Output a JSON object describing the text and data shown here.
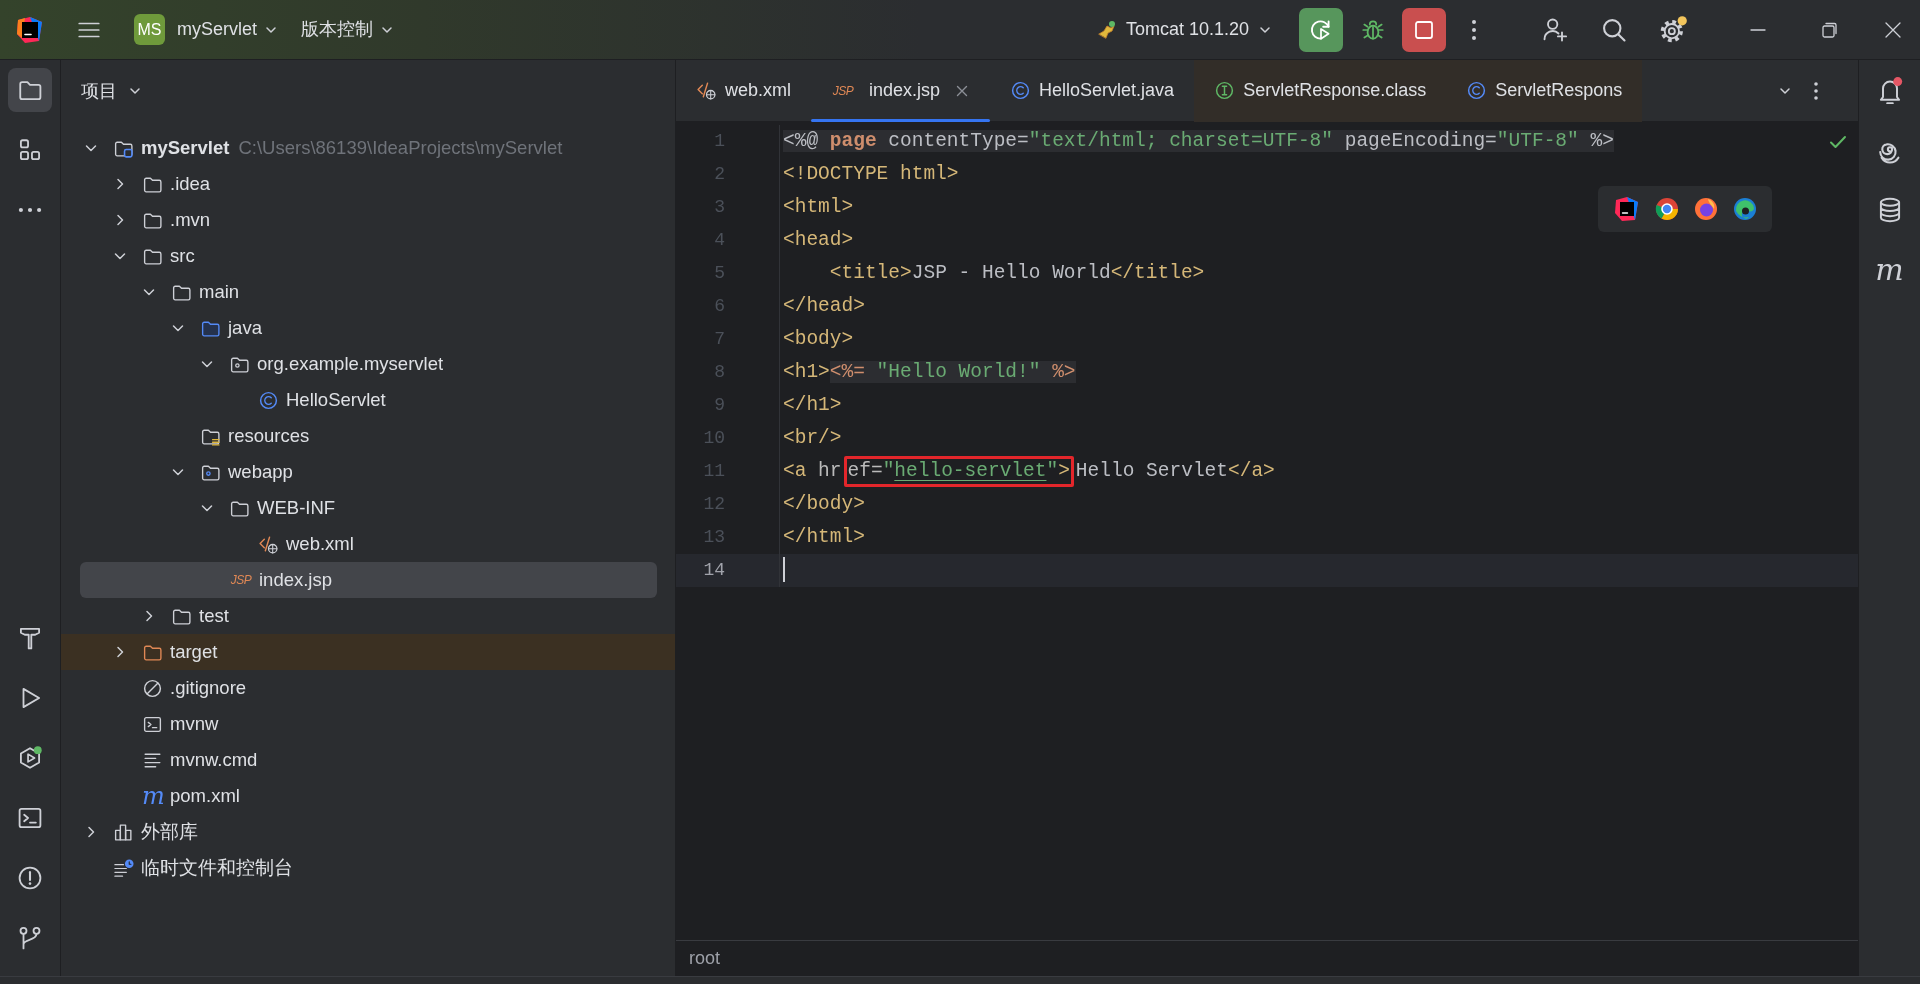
{
  "title_bar": {
    "project": {
      "badge": "MS",
      "name": "myServlet"
    },
    "vcs_menu": "版本控制",
    "run_config": "Tomcat 10.1.20"
  },
  "left_tools_top": [
    {
      "kind": "project",
      "selected": true
    },
    {
      "kind": "structure",
      "selected": false
    },
    {
      "kind": "more",
      "selected": false
    }
  ],
  "left_tools_bottom": [
    {
      "kind": "build",
      "selected": false
    },
    {
      "kind": "run",
      "selected": false
    },
    {
      "kind": "services",
      "selected": false
    },
    {
      "kind": "terminal",
      "selected": false
    },
    {
      "kind": "problems",
      "selected": false
    },
    {
      "kind": "git",
      "selected": false
    }
  ],
  "right_tools": [
    {
      "kind": "notifications"
    },
    {
      "kind": "ai"
    },
    {
      "kind": "database"
    },
    {
      "kind": "maven",
      "glyph": "m"
    }
  ],
  "project_panel": {
    "title": "项目",
    "tree": [
      {
        "label": "myServlet",
        "path": "C:\\Users\\86139\\IdeaProjects\\myServlet",
        "kind": "project",
        "expanded": true,
        "selected": false,
        "children": [
          {
            "label": ".idea",
            "kind": "folder",
            "expanded": false,
            "selected": false
          },
          {
            "label": ".mvn",
            "kind": "folder",
            "expanded": false,
            "selected": false
          },
          {
            "label": "src",
            "kind": "folder",
            "expanded": true,
            "selected": false,
            "children": [
              {
                "label": "main",
                "kind": "folder",
                "expanded": true,
                "selected": false,
                "children": [
                  {
                    "label": "java",
                    "kind": "source",
                    "expanded": true,
                    "selected": false,
                    "children": [
                      {
                        "label": "org.example.myservlet",
                        "kind": "package",
                        "expanded": true,
                        "selected": false,
                        "children": [
                          {
                            "label": "HelloServlet",
                            "kind": "class",
                            "selected": false
                          }
                        ]
                      }
                    ]
                  },
                  {
                    "label": "resources",
                    "kind": "resources",
                    "selected": false
                  },
                  {
                    "label": "webapp",
                    "kind": "webapp",
                    "expanded": true,
                    "selected": false,
                    "children": [
                      {
                        "label": "WEB-INF",
                        "kind": "folder",
                        "expanded": true,
                        "selected": false,
                        "children": [
                          {
                            "label": "web.xml",
                            "kind": "xml",
                            "selected": false
                          }
                        ]
                      },
                      {
                        "label": "index.jsp",
                        "kind": "jsp",
                        "glyph": "JSP",
                        "selected": true
                      }
                    ]
                  }
                ]
              },
              {
                "label": "test",
                "kind": "folder",
                "expanded": false,
                "selected": false
              }
            ]
          },
          {
            "label": "target",
            "kind": "excluded",
            "expanded": false,
            "selected": false
          },
          {
            "label": ".gitignore",
            "kind": "gitignore",
            "selected": false
          },
          {
            "label": "mvnw",
            "kind": "shell",
            "selected": false
          },
          {
            "label": "mvnw.cmd",
            "kind": "text",
            "selected": false
          },
          {
            "label": "pom.xml",
            "kind": "maven",
            "glyph": "m",
            "selected": false
          }
        ]
      },
      {
        "label": "外部库",
        "kind": "library",
        "expanded": false,
        "selected": false
      },
      {
        "label": "临时文件和控制台",
        "kind": "scratch",
        "selected": false
      }
    ]
  },
  "editor": {
    "tabs": [
      {
        "label": "web.xml",
        "kind": "xml",
        "selected": false,
        "library": false
      },
      {
        "label": "index.jsp",
        "kind": "jsp",
        "glyph": "JSP",
        "selected": true,
        "library": false
      },
      {
        "label": "HelloServlet.java",
        "kind": "class",
        "selected": false,
        "library": false
      },
      {
        "label": "ServletResponse.class",
        "kind": "interface",
        "selected": false,
        "library": true
      },
      {
        "label": "ServletRespons",
        "kind": "class",
        "selected": false,
        "library": true
      }
    ],
    "lines": [
      {
        "number": "1",
        "current": false,
        "tokens": [
          {
            "kind": "jsp",
            "tokens": [
              {
                "kind": "text",
                "text": "<%@ "
              },
              {
                "kind": "keyword",
                "text": "page"
              },
              {
                "kind": "text",
                "text": " contentType="
              },
              {
                "kind": "string",
                "text": "\"text/html; charset=UTF-8\""
              },
              {
                "kind": "text",
                "text": " pageEncoding="
              },
              {
                "kind": "string",
                "text": "\"UTF-8\""
              },
              {
                "kind": "text",
                "text": " %>"
              }
            ]
          }
        ]
      },
      {
        "number": "2",
        "current": false,
        "tokens": [
          {
            "kind": "tag",
            "text": "<!DOCTYPE html>"
          }
        ]
      },
      {
        "number": "3",
        "current": false,
        "tokens": [
          {
            "kind": "tag",
            "text": "<html>"
          }
        ]
      },
      {
        "number": "4",
        "current": false,
        "tokens": [
          {
            "kind": "tag",
            "text": "<head>"
          }
        ]
      },
      {
        "number": "5",
        "current": false,
        "tokens": [
          {
            "kind": "tag",
            "text": "    <title>"
          },
          {
            "kind": "text",
            "text": "JSP - Hello World"
          },
          {
            "kind": "tag",
            "text": "</title>"
          }
        ]
      },
      {
        "number": "6",
        "current": false,
        "tokens": [
          {
            "kind": "tag",
            "text": "</head>"
          }
        ]
      },
      {
        "number": "7",
        "current": false,
        "tokens": [
          {
            "kind": "tag",
            "text": "<body>"
          }
        ]
      },
      {
        "number": "8",
        "current": false,
        "tokens": [
          {
            "kind": "tag",
            "text": "<h1>"
          },
          {
            "kind": "jsp",
            "tokens": [
              {
                "kind": "delim",
                "text": "<%="
              },
              {
                "kind": "string",
                "text": " \"Hello World!\""
              },
              {
                "kind": "delim",
                "text": " %>"
              }
            ]
          }
        ]
      },
      {
        "number": "9",
        "current": false,
        "tokens": [
          {
            "kind": "tag",
            "text": "</h1>"
          }
        ]
      },
      {
        "number": "10",
        "current": false,
        "tokens": [
          {
            "kind": "tag",
            "text": "<br/>"
          }
        ]
      },
      {
        "number": "11",
        "current": false,
        "tokens": [
          {
            "kind": "tag",
            "text": "<a"
          },
          {
            "kind": "attr",
            "text": " hr"
          },
          {
            "kind": "boxed",
            "tokens": [
              {
                "kind": "attr",
                "text": "ef="
              },
              {
                "kind": "string",
                "text": "\""
              },
              {
                "kind": "link",
                "text": "hello-servlet"
              },
              {
                "kind": "string",
                "text": "\""
              },
              {
                "kind": "tag",
                "text": ">"
              }
            ]
          },
          {
            "kind": "text",
            "text": "Hello Servlet"
          },
          {
            "kind": "tag",
            "text": "</a>"
          }
        ]
      },
      {
        "number": "12",
        "current": false,
        "tokens": [
          {
            "kind": "tag",
            "text": "</body>"
          }
        ]
      },
      {
        "number": "13",
        "current": false,
        "tokens": [
          {
            "kind": "tag",
            "text": "</html>"
          }
        ]
      },
      {
        "number": "14",
        "current": true
      }
    ],
    "breadcrumb": "root"
  }
}
